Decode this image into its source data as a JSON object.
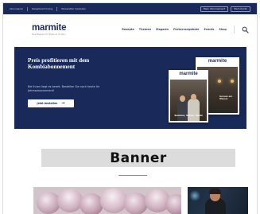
{
  "topbar": {
    "links": [
      "Abonnieren",
      "Rezeptsammlung",
      "Newsletter bestellen"
    ],
    "buttons": [
      "Mein Abonnement",
      "Mein Konto"
    ]
  },
  "header": {
    "logo": "marmite",
    "tagline": "Das Magazin für Essen & Trinken",
    "nav": [
      "Rezepte",
      "Themen",
      "Magazin",
      "Partnerangebote",
      "Events",
      "Shop"
    ],
    "search_icon": "search-icon"
  },
  "hero": {
    "title": "Preis profitieren mit dem Kombiabonnement",
    "subtitle": "Bei Ihnen liegt es bereit. Bestellen Sie noch heute Ihr Jahresabonnement!",
    "cta_label": "Jetzt bestellen",
    "magazine_front_title": "marmite",
    "magazine_front_caption": "Sommer, Sonne, Sushi",
    "magazine_back_title": "marmite",
    "magazine_back_caption": "Genuss am Wasser"
  },
  "banner": {
    "label": "Banner"
  },
  "colors": {
    "navy": "#18295a",
    "logo": "#1e2e5c",
    "banner_gray": "#dcdcdc"
  }
}
